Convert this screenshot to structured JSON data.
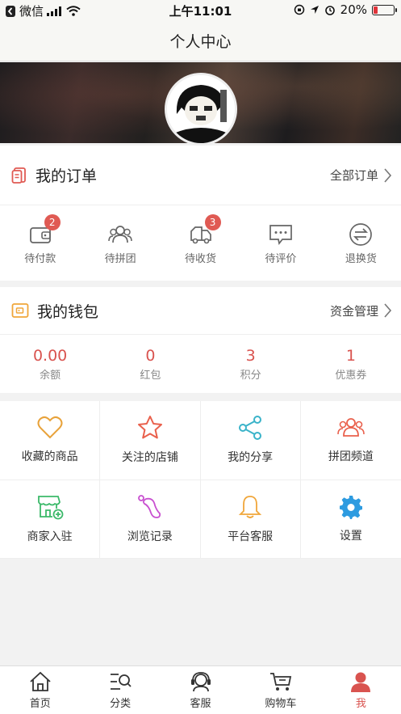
{
  "status_bar": {
    "back_app": "微信",
    "time": "上午11:01",
    "battery": "20%",
    "battery_level": 0.2
  },
  "nav": {
    "title": "个人中心"
  },
  "orders": {
    "title": "我的订单",
    "all_label": "全部订单",
    "items": [
      {
        "label": "待付款",
        "badge": "2",
        "icon": "wallet-icon"
      },
      {
        "label": "待拼团",
        "badge": "",
        "icon": "group-icon"
      },
      {
        "label": "待收货",
        "badge": "3",
        "icon": "truck-icon"
      },
      {
        "label": "待评价",
        "badge": "",
        "icon": "comment-icon"
      },
      {
        "label": "退换货",
        "badge": "",
        "icon": "exchange-icon"
      }
    ]
  },
  "wallet": {
    "title": "我的钱包",
    "manage_label": "资金管理",
    "items": [
      {
        "value": "0.00",
        "label": "余额"
      },
      {
        "value": "0",
        "label": "红包"
      },
      {
        "value": "3",
        "label": "积分"
      },
      {
        "value": "1",
        "label": "优惠券"
      }
    ]
  },
  "services": [
    {
      "label": "收藏的商品",
      "icon": "heart-icon",
      "color": "#e8a23a"
    },
    {
      "label": "关注的店铺",
      "icon": "star-icon",
      "color": "#e9604c"
    },
    {
      "label": "我的分享",
      "icon": "share-icon",
      "color": "#3ab3c9"
    },
    {
      "label": "拼团频道",
      "icon": "group-icon",
      "color": "#e9604c"
    },
    {
      "label": "商家入驻",
      "icon": "store-icon",
      "color": "#3cb96a"
    },
    {
      "label": "浏览记录",
      "icon": "footprint-icon",
      "color": "#c84fd0"
    },
    {
      "label": "平台客服",
      "icon": "bell-icon",
      "color": "#f0a63a"
    },
    {
      "label": "设置",
      "icon": "gear-icon",
      "color": "#2d9be0"
    }
  ],
  "tabs": [
    {
      "label": "首页",
      "icon": "home-icon"
    },
    {
      "label": "分类",
      "icon": "category-icon"
    },
    {
      "label": "客服",
      "icon": "headset-icon"
    },
    {
      "label": "购物车",
      "icon": "cart-icon"
    },
    {
      "label": "我",
      "icon": "person-icon"
    }
  ],
  "colors": {
    "accent": "#d9534f",
    "badge": "#e05a53"
  }
}
